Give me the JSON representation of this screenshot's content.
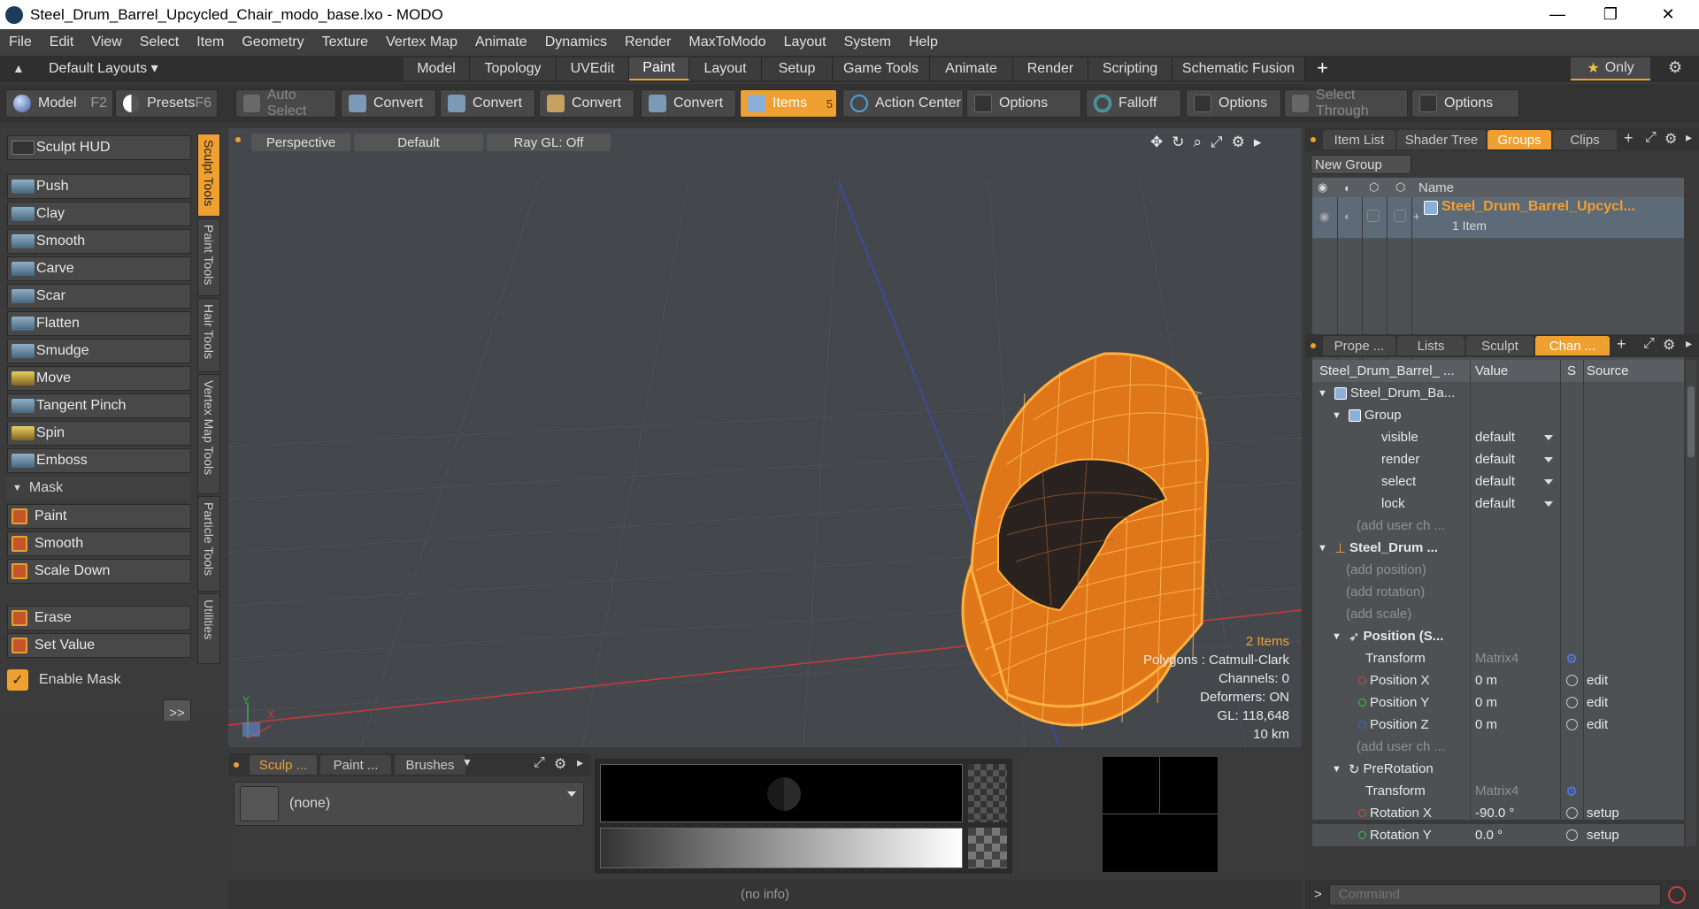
{
  "window": {
    "title": "Steel_Drum_Barrel_Upcycled_Chair_modo_base.lxo - MODO",
    "minimize": "—",
    "maximize": "❐",
    "close": "✕"
  },
  "menu": [
    "File",
    "Edit",
    "View",
    "Select",
    "Item",
    "Geometry",
    "Texture",
    "Vertex Map",
    "Animate",
    "Dynamics",
    "Render",
    "MaxToModo",
    "Layout",
    "System",
    "Help"
  ],
  "layouts": {
    "dropdown": "Default Layouts",
    "tabs": [
      "Model",
      "Topology",
      "UVEdit",
      "Paint",
      "Layout",
      "Setup",
      "Game Tools",
      "Animate",
      "Render",
      "Scripting",
      "Schematic Fusion"
    ],
    "active_tab": "Paint",
    "add": "+",
    "only": "Only"
  },
  "toolbar": {
    "model": "Model",
    "model_key": "F2",
    "presets": "Presets",
    "presets_key": "F6",
    "auto_select": "Auto Select",
    "convert": "Convert",
    "items": "Items",
    "items_count": "5",
    "action_center": "Action Center",
    "options": "Options",
    "falloff": "Falloff",
    "select_through": "Select Through"
  },
  "left": {
    "sculpt_hud": "Sculpt HUD",
    "tools": [
      "Push",
      "Clay",
      "Smooth",
      "Carve",
      "Scar",
      "Flatten",
      "Smudge",
      "Move",
      "Tangent Pinch",
      "Spin",
      "Emboss"
    ],
    "mask_header": "Mask",
    "mask_tools": [
      "Paint",
      "Smooth",
      "Scale Down"
    ],
    "erase": "Erase",
    "set_value": "Set Value",
    "enable_mask": "Enable Mask",
    "expand": ">>",
    "vtabs": [
      "Sculpt Tools",
      "Paint Tools",
      "Hair Tools",
      "Vertex Map Tools",
      "Particle Tools",
      "Utilities"
    ]
  },
  "viewport": {
    "view": "Perspective",
    "shading": "Default",
    "raygl": "Ray GL: Off",
    "info": {
      "items": "2 Items",
      "polygons": "Polygons : Catmull-Clark",
      "channels": "Channels: 0",
      "deformers": "Deformers: ON",
      "gl": "GL: 118,648",
      "scale": "10 km"
    },
    "axis_y": "Y",
    "axis_x": "X"
  },
  "bottom": {
    "tabs": [
      "Sculp ...",
      "Paint ...",
      "Brushes"
    ],
    "preset": "(none)",
    "status": "(no info)"
  },
  "right": {
    "top_tabs": [
      "Item List",
      "Shader Tree",
      "Groups",
      "Clips"
    ],
    "active_top": "Groups",
    "new_group": "New Group",
    "name_header": "Name",
    "group_name": "Steel_Drum_Barrel_Upcycl...",
    "group_count": "1 Item",
    "mid_tabs": [
      "Prope ...",
      "Lists",
      "Sculpt",
      "Chan ..."
    ],
    "active_mid": "Chan ...",
    "col_headers": [
      "Steel_Drum_Barrel_ ...",
      "Value",
      "S",
      "Source"
    ],
    "rows": [
      {
        "label": "Steel_Drum_Ba...",
        "value": "",
        "source": ""
      },
      {
        "label": "Group",
        "value": "",
        "source": ""
      },
      {
        "label": "visible",
        "value": "default",
        "source": ""
      },
      {
        "label": "render",
        "value": "default",
        "source": ""
      },
      {
        "label": "select",
        "value": "default",
        "source": ""
      },
      {
        "label": "lock",
        "value": "default",
        "source": ""
      },
      {
        "label": "(add user ch ...",
        "value": "",
        "source": ""
      },
      {
        "label": "Steel_Drum ...",
        "value": "",
        "source": ""
      },
      {
        "label": "(add position)",
        "value": "",
        "source": ""
      },
      {
        "label": "(add rotation)",
        "value": "",
        "source": ""
      },
      {
        "label": "(add scale)",
        "value": "",
        "source": ""
      },
      {
        "label": "Position (S...",
        "value": "",
        "source": ""
      },
      {
        "label": "Transform",
        "value": "Matrix4",
        "source": ""
      },
      {
        "label": "Position X",
        "value": "0 m",
        "source": "edit"
      },
      {
        "label": "Position Y",
        "value": "0 m",
        "source": "edit"
      },
      {
        "label": "Position Z",
        "value": "0 m",
        "source": "edit"
      },
      {
        "label": "(add user ch ...",
        "value": "",
        "source": ""
      },
      {
        "label": "PreRotation",
        "value": "",
        "source": ""
      },
      {
        "label": "Transform",
        "value": "Matrix4",
        "source": ""
      },
      {
        "label": "Rotation X",
        "value": "-90.0 °",
        "source": "setup"
      },
      {
        "label": "Rotation Y",
        "value": "0.0 °",
        "source": "setup"
      }
    ],
    "command_placeholder": "Command",
    "prompt": ">"
  },
  "colors": {
    "accent": "#f0a030",
    "mesh": "#ff9a1a",
    "axis_x": "#c83a3a",
    "axis_z": "#3a4ab8"
  }
}
